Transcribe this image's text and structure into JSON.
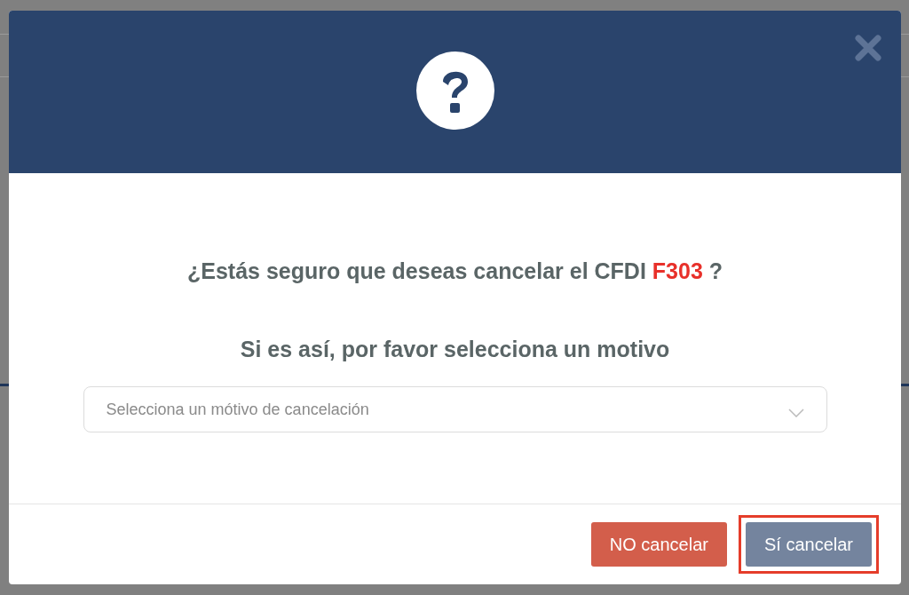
{
  "dialog": {
    "question": {
      "before": "¿Estás seguro que deseas cancelar el CFDI",
      "code": "F303",
      "after": "?"
    },
    "subtitle": "Si es así, por favor selecciona un motivo",
    "select": {
      "placeholder": "Selecciona un mótivo de cancelación"
    },
    "buttons": [
      {
        "label": "NO cancelar",
        "kind": "danger",
        "highlighted": false
      },
      {
        "label": "Sí cancelar",
        "kind": "confirm",
        "highlighted": true
      }
    ]
  }
}
